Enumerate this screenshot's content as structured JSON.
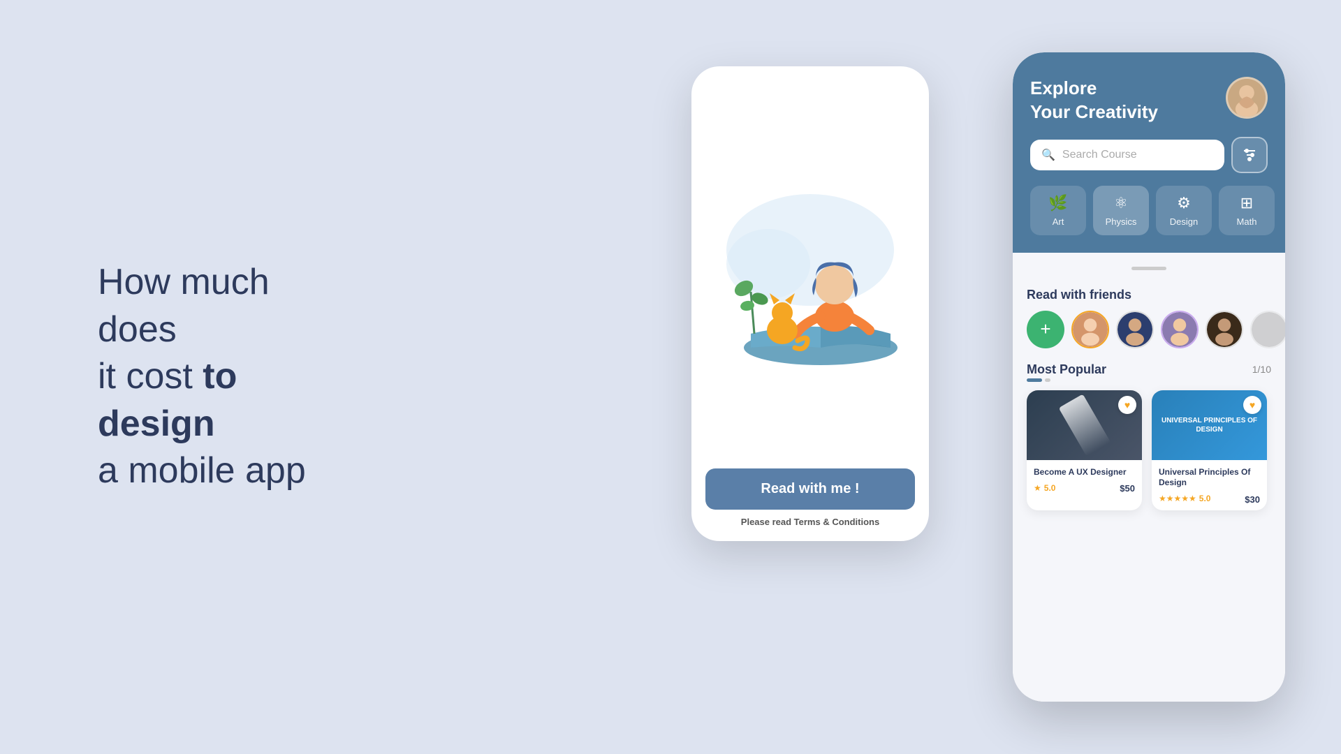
{
  "page": {
    "background": "#dde3f0"
  },
  "left_text": {
    "line1": "How much does",
    "line2": "it cost ",
    "bold": "to design",
    "line3": "a mobile app"
  },
  "phone_back": {
    "button_label": "Read with me !",
    "terms_text": "Please read ",
    "terms_link": "Terms & Conditions"
  },
  "phone_front": {
    "header": {
      "title_line1": "Explore",
      "title_line2": "Your Creativity",
      "search_placeholder": "Search Course"
    },
    "categories": [
      {
        "label": "Art",
        "icon": "🌿",
        "active": false
      },
      {
        "label": "Physics",
        "icon": "⚛",
        "active": true
      },
      {
        "label": "Design",
        "icon": "🔧",
        "active": false
      },
      {
        "label": "Math",
        "icon": "⊞",
        "active": false
      }
    ],
    "friends_section": {
      "title": "Read with friends"
    },
    "popular_section": {
      "title": "Most Popular",
      "pagination": "1/10",
      "cards": [
        {
          "title": "Become A UX Designer",
          "rating": "5.0",
          "price": "$50",
          "thumb_type": "dark",
          "heart": true
        },
        {
          "title": "Universal Principles Of Design",
          "rating": "5.0",
          "price": "$30",
          "thumb_type": "blue",
          "thumb_text": "UNIVERSAL PRINCIPLES OF DESIGN",
          "heart": true
        }
      ]
    }
  }
}
